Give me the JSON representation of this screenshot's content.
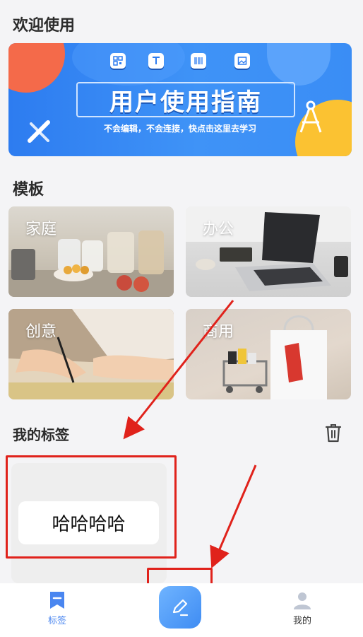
{
  "welcome": {
    "title": "欢迎使用"
  },
  "banner": {
    "title": "用户使用指南",
    "subtitle": "不会编辑，不会连接，快点击这里去学习",
    "icons": [
      "qr-code-icon",
      "text-tool-icon",
      "barcode-icon",
      "image-icon"
    ]
  },
  "templates": {
    "title": "模板",
    "items": [
      {
        "label": "家庭"
      },
      {
        "label": "办公"
      },
      {
        "label": "创意"
      },
      {
        "label": "商用"
      }
    ]
  },
  "tags": {
    "title": "我的标签",
    "items": [
      {
        "text": "哈哈哈哈"
      }
    ]
  },
  "bottom_nav": {
    "tags_label": "标签",
    "mine_label": "我的"
  },
  "colors": {
    "accent": "#4a86f0",
    "annotation": "#e0221b",
    "banner_blue": "#2d7cf0"
  }
}
